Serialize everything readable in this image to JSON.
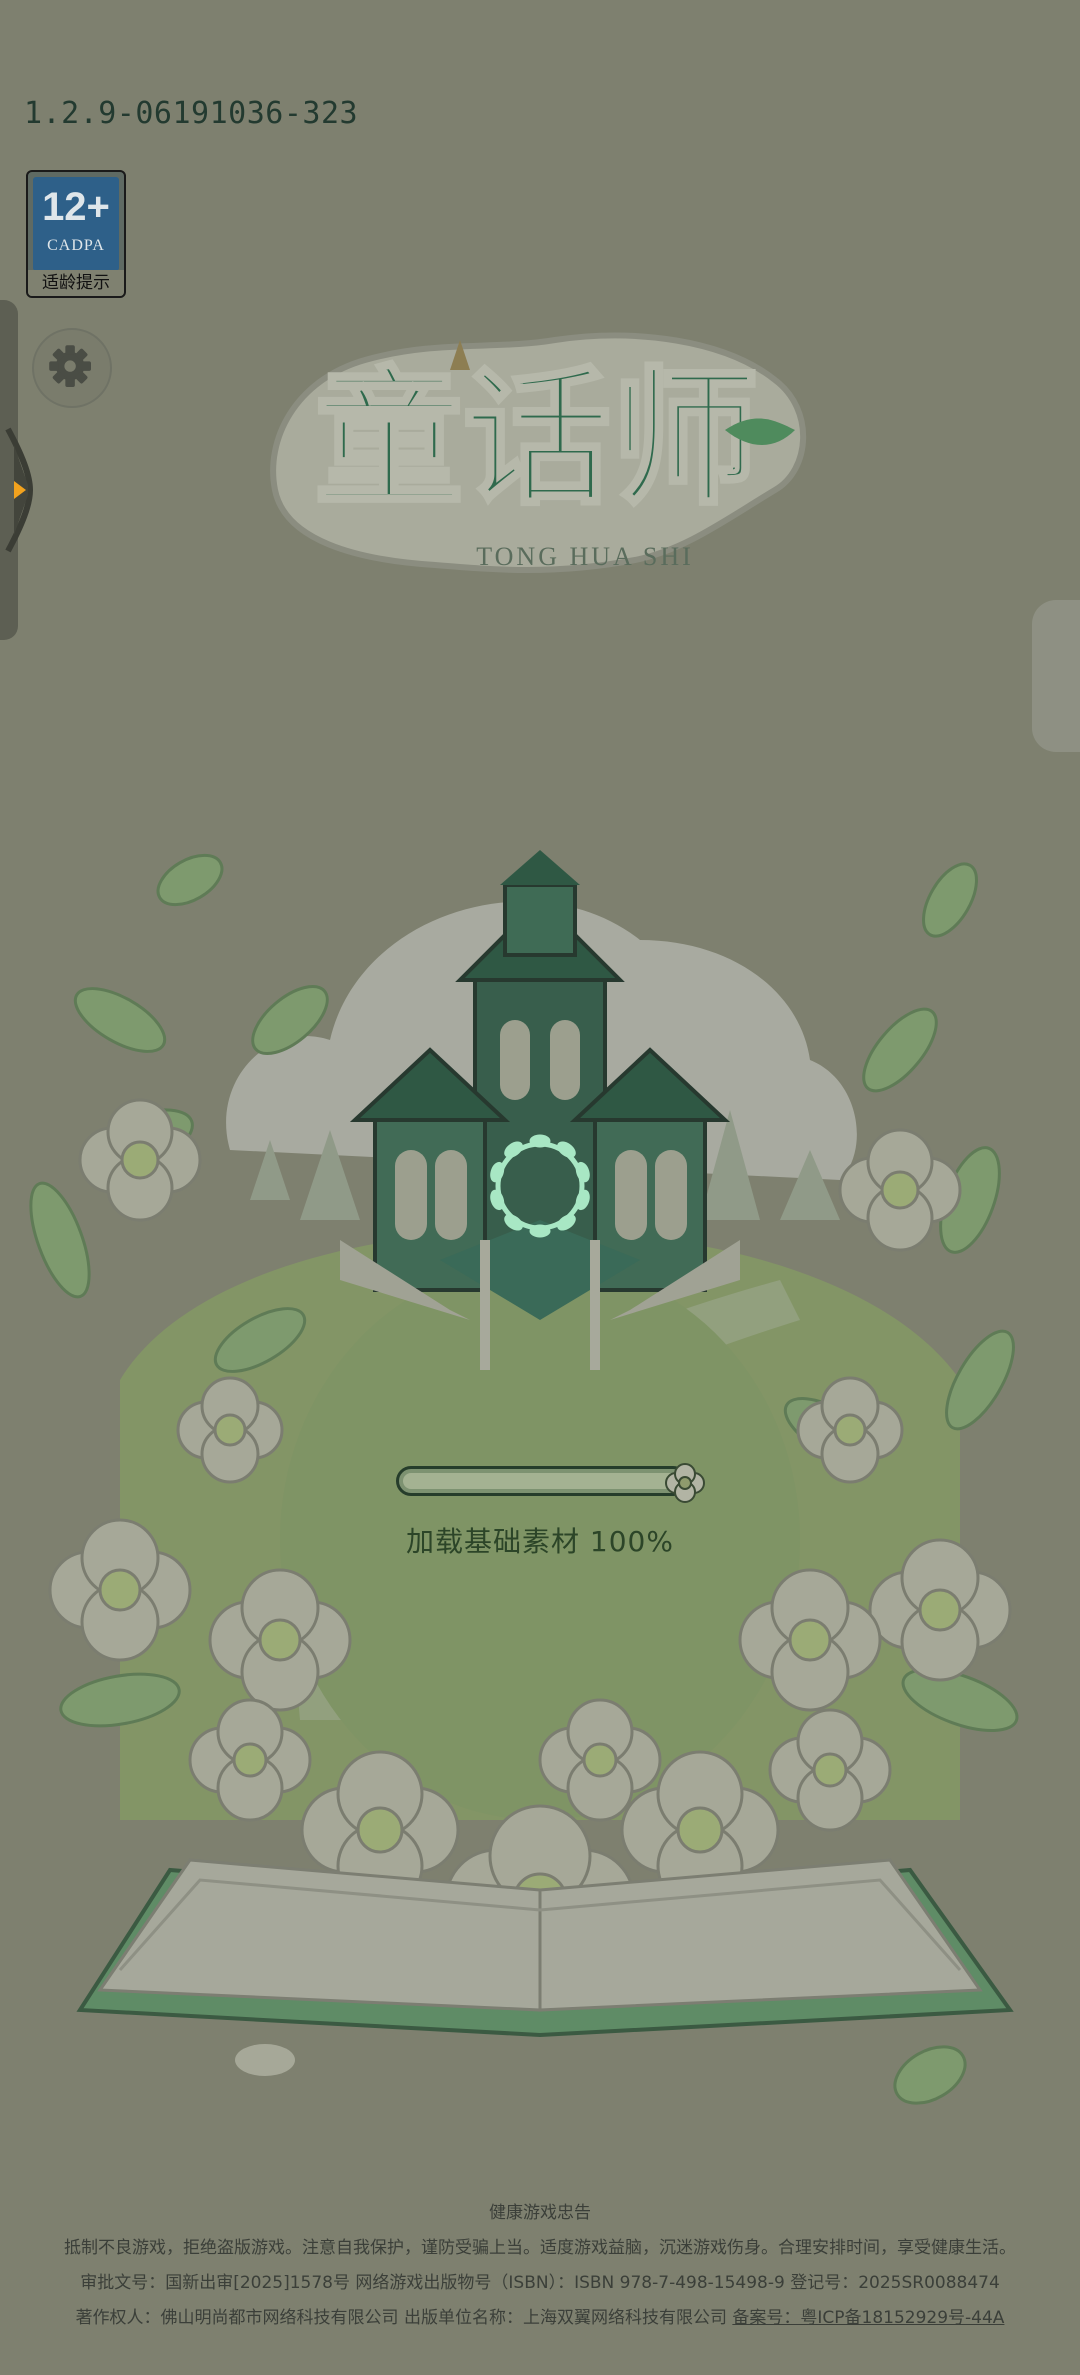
{
  "version": "1.2.9-06191036-323",
  "age_rating": {
    "number": "12+",
    "org": "CADPA",
    "caption": "适龄提示"
  },
  "icons": {
    "settings": "gear-icon",
    "side_panel": "chevron-right-icon",
    "loading": "leaf-wreath-spinner-icon"
  },
  "logo": {
    "title": "童话师",
    "subtitle": "TONG HUA SHI"
  },
  "loading": {
    "label": "加载基础素材 100%",
    "progress": 1.0
  },
  "footer": {
    "title": "健康游戏忠告",
    "line1": "抵制不良游戏，拒绝盗版游戏。注意自我保护，谨防受骗上当。适度游戏益脑，沉迷游戏伤身。合理安排时间，享受健康生活。",
    "line2": "审批文号：国新出审[2025]1578号 网络游戏出版物号（ISBN）：ISBN 978-7-498-15498-9 登记号：2025SR0088474",
    "line3_main": "著作权人：佛山明尚都市网络科技有限公司 出版单位名称：上海双翼网络科技有限公司 ",
    "line3_icp": "备案号：粤ICP备18152929号-44A"
  },
  "colors": {
    "overlay": "#7e806f",
    "logo_green": "#2f6a4d",
    "spinner": "#a8e7c4"
  }
}
